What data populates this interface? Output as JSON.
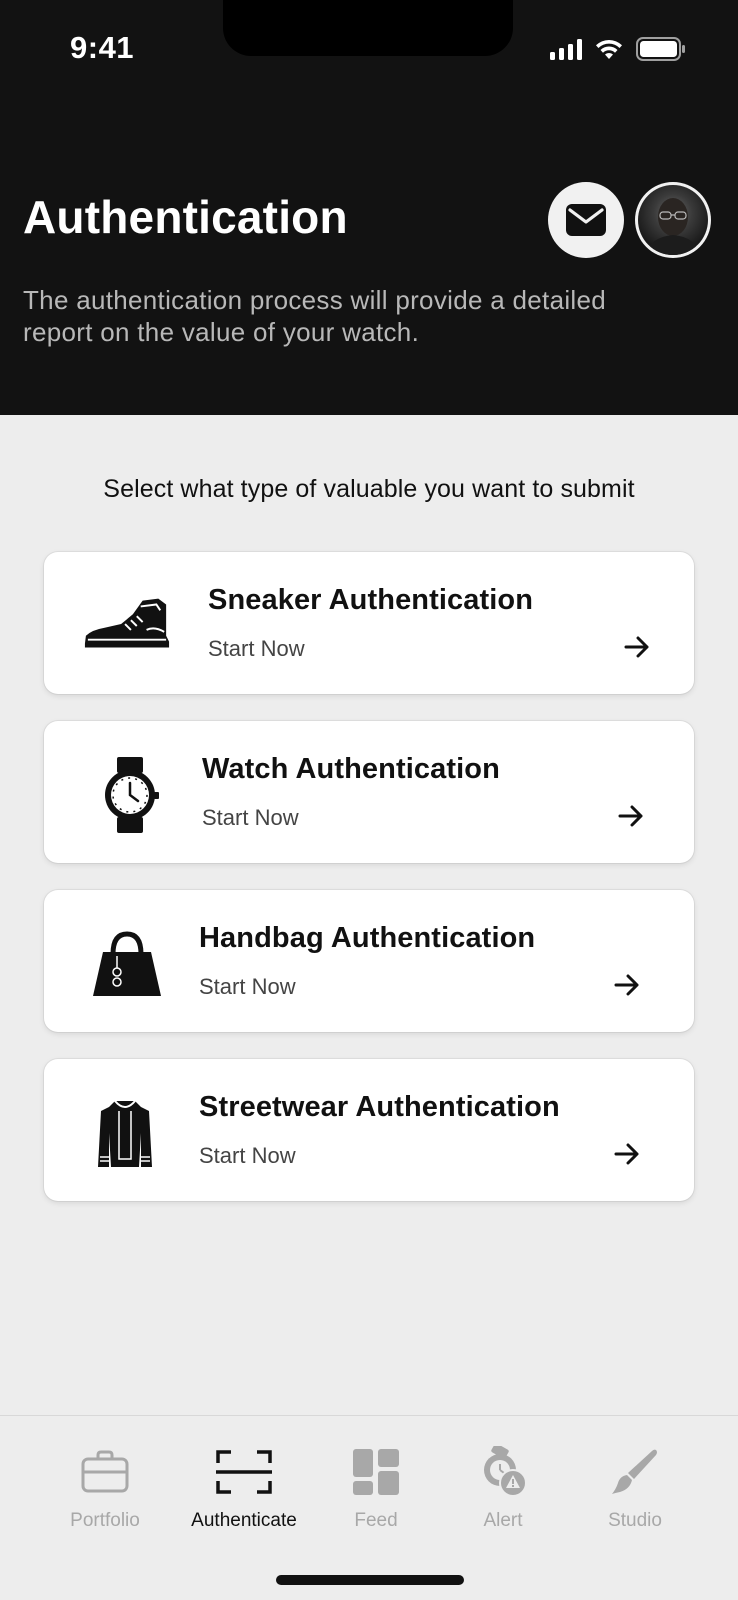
{
  "status_bar": {
    "time": "9:41"
  },
  "header": {
    "title": "Authentication",
    "description": "The authentication process will provide a detailed report on the value of your watch."
  },
  "prompt": "Select what type of valuable you want to submit",
  "cards": [
    {
      "title": "Sneaker Authentication",
      "action": "Start Now",
      "icon": "sneaker-icon"
    },
    {
      "title": "Watch Authentication",
      "action": "Start Now",
      "icon": "watch-icon"
    },
    {
      "title": "Handbag Authentication",
      "action": "Start Now",
      "icon": "handbag-icon"
    },
    {
      "title": "Streetwear Authentication",
      "action": "Start Now",
      "icon": "jacket-icon"
    }
  ],
  "tabbar": {
    "items": [
      {
        "label": "Portfolio",
        "icon": "briefcase-icon",
        "active": false
      },
      {
        "label": "Authenticate",
        "icon": "scan-icon",
        "active": true
      },
      {
        "label": "Feed",
        "icon": "grid-icon",
        "active": false
      },
      {
        "label": "Alert",
        "icon": "watch-alert-icon",
        "active": false
      },
      {
        "label": "Studio",
        "icon": "brush-icon",
        "active": false
      }
    ]
  },
  "colors": {
    "header_bg": "#121212",
    "page_bg": "#ededed",
    "card_bg": "#ffffff",
    "active_tab": "#111111",
    "inactive_tab": "#a8a8a8"
  }
}
